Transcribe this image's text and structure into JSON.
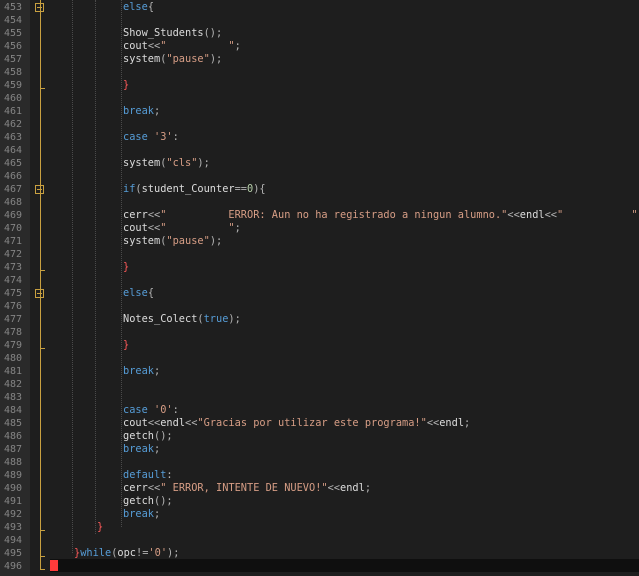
{
  "colors": {
    "background": "#1e1e1e",
    "gutter": "#2a2a2a",
    "keyword": "#569cd6",
    "string": "#d69d85",
    "number": "#b5cea8",
    "operator": "#b4b4b4",
    "fold_marker": "#c8a040",
    "cursor": "#ff3b3b"
  },
  "editor": {
    "lines": [
      {
        "n": "453",
        "fold": "box",
        "seg": [
          {
            "t": "else",
            "c": "kw"
          },
          {
            "t": "{",
            "c": "op"
          }
        ]
      },
      {
        "n": "454",
        "seg": []
      },
      {
        "n": "455",
        "seg": [
          {
            "t": "Show_Students",
            "c": "fn"
          },
          {
            "t": "();",
            "c": "op"
          }
        ]
      },
      {
        "n": "456",
        "seg": [
          {
            "t": "cout",
            "c": "id"
          },
          {
            "t": "<<",
            "c": "op"
          },
          {
            "t": "\"          \"",
            "c": "str"
          },
          {
            "t": ";",
            "c": "op"
          }
        ]
      },
      {
        "n": "457",
        "seg": [
          {
            "t": "system",
            "c": "fn"
          },
          {
            "t": "(",
            "c": "op"
          },
          {
            "t": "\"pause\"",
            "c": "str"
          },
          {
            "t": ");",
            "c": "op"
          }
        ]
      },
      {
        "n": "458",
        "seg": []
      },
      {
        "n": "459",
        "fold": "end",
        "seg": [
          {
            "t": "}",
            "c": "red"
          }
        ]
      },
      {
        "n": "460",
        "seg": []
      },
      {
        "n": "461",
        "seg": [
          {
            "t": "break",
            "c": "kw"
          },
          {
            "t": ";",
            "c": "op"
          }
        ]
      },
      {
        "n": "462",
        "seg": []
      },
      {
        "n": "463",
        "seg": [
          {
            "t": "case",
            "c": "kw"
          },
          {
            "t": " ",
            "c": "pn"
          },
          {
            "t": "'3'",
            "c": "str"
          },
          {
            "t": ":",
            "c": "op"
          }
        ]
      },
      {
        "n": "464",
        "seg": []
      },
      {
        "n": "465",
        "seg": [
          {
            "t": "system",
            "c": "fn"
          },
          {
            "t": "(",
            "c": "op"
          },
          {
            "t": "\"cls\"",
            "c": "str"
          },
          {
            "t": ");",
            "c": "op"
          }
        ]
      },
      {
        "n": "466",
        "seg": []
      },
      {
        "n": "467",
        "fold": "box",
        "seg": [
          {
            "t": "if",
            "c": "kw"
          },
          {
            "t": "(",
            "c": "op"
          },
          {
            "t": "student_Counter",
            "c": "id"
          },
          {
            "t": "==",
            "c": "op"
          },
          {
            "t": "0",
            "c": "num"
          },
          {
            "t": "){",
            "c": "op"
          }
        ]
      },
      {
        "n": "468",
        "seg": []
      },
      {
        "n": "469",
        "seg": [
          {
            "t": "cerr",
            "c": "id"
          },
          {
            "t": "<<",
            "c": "op"
          },
          {
            "t": "\"          ERROR: Aun no ha registrado a ningun alumno.\"",
            "c": "str"
          },
          {
            "t": "<<",
            "c": "op"
          },
          {
            "t": "endl",
            "c": "id"
          },
          {
            "t": "<<",
            "c": "op"
          },
          {
            "t": "\"           \"",
            "c": "str"
          },
          {
            "t": ";",
            "c": "op"
          }
        ]
      },
      {
        "n": "470",
        "seg": [
          {
            "t": "cout",
            "c": "id"
          },
          {
            "t": "<<",
            "c": "op"
          },
          {
            "t": "\"          \"",
            "c": "str"
          },
          {
            "t": ";",
            "c": "op"
          }
        ]
      },
      {
        "n": "471",
        "seg": [
          {
            "t": "system",
            "c": "fn"
          },
          {
            "t": "(",
            "c": "op"
          },
          {
            "t": "\"pause\"",
            "c": "str"
          },
          {
            "t": ");",
            "c": "op"
          }
        ]
      },
      {
        "n": "472",
        "seg": []
      },
      {
        "n": "473",
        "fold": "end",
        "seg": [
          {
            "t": "}",
            "c": "red"
          }
        ]
      },
      {
        "n": "474",
        "seg": []
      },
      {
        "n": "475",
        "fold": "box",
        "seg": [
          {
            "t": "else",
            "c": "kw"
          },
          {
            "t": "{",
            "c": "op"
          }
        ]
      },
      {
        "n": "476",
        "seg": []
      },
      {
        "n": "477",
        "seg": [
          {
            "t": "Notes_Colect",
            "c": "fn"
          },
          {
            "t": "(",
            "c": "op"
          },
          {
            "t": "true",
            "c": "kw"
          },
          {
            "t": ");",
            "c": "op"
          }
        ]
      },
      {
        "n": "478",
        "seg": []
      },
      {
        "n": "479",
        "fold": "end",
        "seg": [
          {
            "t": "}",
            "c": "red"
          }
        ]
      },
      {
        "n": "480",
        "seg": []
      },
      {
        "n": "481",
        "seg": [
          {
            "t": "break",
            "c": "kw"
          },
          {
            "t": ";",
            "c": "op"
          }
        ]
      },
      {
        "n": "482",
        "seg": []
      },
      {
        "n": "483",
        "seg": []
      },
      {
        "n": "484",
        "seg": [
          {
            "t": "case",
            "c": "kw"
          },
          {
            "t": " ",
            "c": "pn"
          },
          {
            "t": "'0'",
            "c": "str"
          },
          {
            "t": ":",
            "c": "op"
          }
        ]
      },
      {
        "n": "485",
        "seg": [
          {
            "t": "cout",
            "c": "id"
          },
          {
            "t": "<<",
            "c": "op"
          },
          {
            "t": "endl",
            "c": "id"
          },
          {
            "t": "<<",
            "c": "op"
          },
          {
            "t": "\"Gracias por utilizar este programa!\"",
            "c": "str"
          },
          {
            "t": "<<",
            "c": "op"
          },
          {
            "t": "endl",
            "c": "id"
          },
          {
            "t": ";",
            "c": "op"
          }
        ]
      },
      {
        "n": "486",
        "seg": [
          {
            "t": "getch",
            "c": "fn"
          },
          {
            "t": "();",
            "c": "op"
          }
        ]
      },
      {
        "n": "487",
        "seg": [
          {
            "t": "break",
            "c": "kw"
          },
          {
            "t": ";",
            "c": "op"
          }
        ]
      },
      {
        "n": "488",
        "seg": []
      },
      {
        "n": "489",
        "seg": [
          {
            "t": "default",
            "c": "kw"
          },
          {
            "t": ":",
            "c": "op"
          }
        ]
      },
      {
        "n": "490",
        "seg": [
          {
            "t": "cerr",
            "c": "id"
          },
          {
            "t": "<<",
            "c": "op"
          },
          {
            "t": "\" ERROR, INTENTE DE NUEVO!\"",
            "c": "str"
          },
          {
            "t": "<<",
            "c": "op"
          },
          {
            "t": "endl",
            "c": "id"
          },
          {
            "t": ";",
            "c": "op"
          }
        ]
      },
      {
        "n": "491",
        "seg": [
          {
            "t": "getch",
            "c": "fn"
          },
          {
            "t": "();",
            "c": "op"
          }
        ]
      },
      {
        "n": "492",
        "seg": [
          {
            "t": "break",
            "c": "kw"
          },
          {
            "t": ";",
            "c": "op"
          }
        ]
      },
      {
        "n": "493",
        "fold": "end",
        "seg": [
          {
            "t": "}",
            "c": "red"
          }
        ]
      },
      {
        "n": "494",
        "seg": []
      },
      {
        "n": "495",
        "fold": "end",
        "seg": [
          {
            "t": "}",
            "c": "red"
          },
          {
            "t": "while",
            "c": "kw"
          },
          {
            "t": "(",
            "c": "op"
          },
          {
            "t": "opc",
            "c": "id"
          },
          {
            "t": "!=",
            "c": "op"
          },
          {
            "t": "'0'",
            "c": "str"
          },
          {
            "t": ");",
            "c": "op"
          }
        ]
      },
      {
        "n": "496",
        "fold": "end",
        "seg": []
      }
    ]
  }
}
